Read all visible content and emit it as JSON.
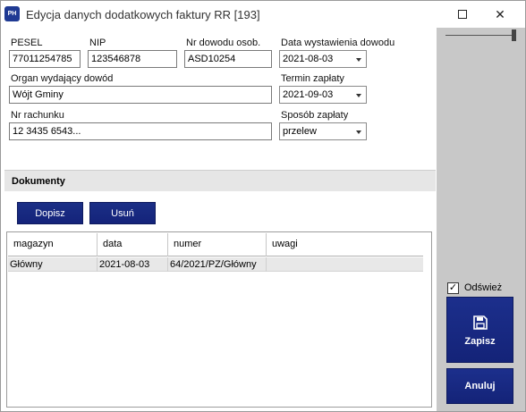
{
  "window": {
    "app_icon_text": "PH",
    "title": "Edycja danych dodatkowych faktury RR [193]",
    "minimize": "—",
    "maximize": "☐",
    "close": "✕"
  },
  "form": {
    "pesel_label": "PESEL",
    "pesel_value": "77011254785",
    "nip_label": "NIP",
    "nip_value": "123546878",
    "id_label": "Nr dowodu osob.",
    "id_value": "ASD10254",
    "issue_date_label": "Data wystawienia dowodu",
    "issue_date_value": "2021-08-03",
    "authority_label": "Organ wydający dowód",
    "authority_value": "Wójt Gminy",
    "due_label": "Termin zapłaty",
    "due_value": "2021-09-03",
    "account_label": "Nr rachunku",
    "account_value": "12 3435 6543...",
    "payment_label": "Sposób zapłaty",
    "payment_value": "przelew"
  },
  "documents": {
    "header": "Dokumenty",
    "add_button": "Dopisz",
    "remove_button": "Usuń",
    "columns": [
      "magazyn",
      "data",
      "numer",
      "uwagi"
    ],
    "rows": [
      [
        "Główny",
        "2021-08-03",
        "64/2021/PZ/Główny",
        ""
      ]
    ]
  },
  "actions": {
    "refresh_label": "Odśwież",
    "refresh_checked": true,
    "save_label": "Zapisz",
    "cancel_label": "Anuluj"
  },
  "colors": {
    "accent": "#1b2f86",
    "side_panel": "#c8c8c8"
  }
}
